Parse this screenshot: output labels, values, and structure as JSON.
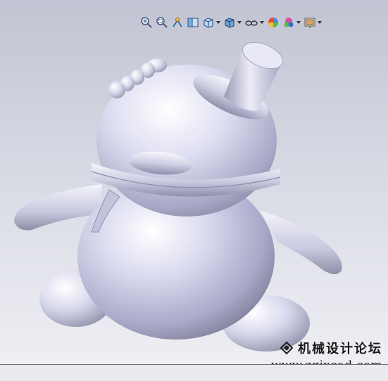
{
  "toolbar": {
    "items": [
      {
        "name": "zoom-to-fit-icon",
        "dropdown": false
      },
      {
        "name": "zoom-to-area-icon",
        "dropdown": false
      },
      {
        "name": "previous-view-icon",
        "dropdown": false
      },
      {
        "name": "section-view-icon",
        "dropdown": false
      },
      {
        "name": "view-orientation-icon",
        "dropdown": true
      },
      {
        "name": "display-style-icon",
        "dropdown": true
      },
      {
        "name": "hide-show-items-icon",
        "dropdown": true
      },
      {
        "name": "edit-appearance-icon",
        "dropdown": false
      },
      {
        "name": "apply-scene-icon",
        "dropdown": true
      },
      {
        "name": "view-settings-icon",
        "dropdown": true
      }
    ]
  },
  "model": {
    "name": "penguin-with-top-hat",
    "color": "#d4d4ec"
  },
  "watermark": {
    "title": "机械设计论坛",
    "url": "www.zgjxcad.com"
  },
  "colors": {
    "viewport_top": "#c2c4d3",
    "viewport_bottom": "#eeeff3"
  }
}
